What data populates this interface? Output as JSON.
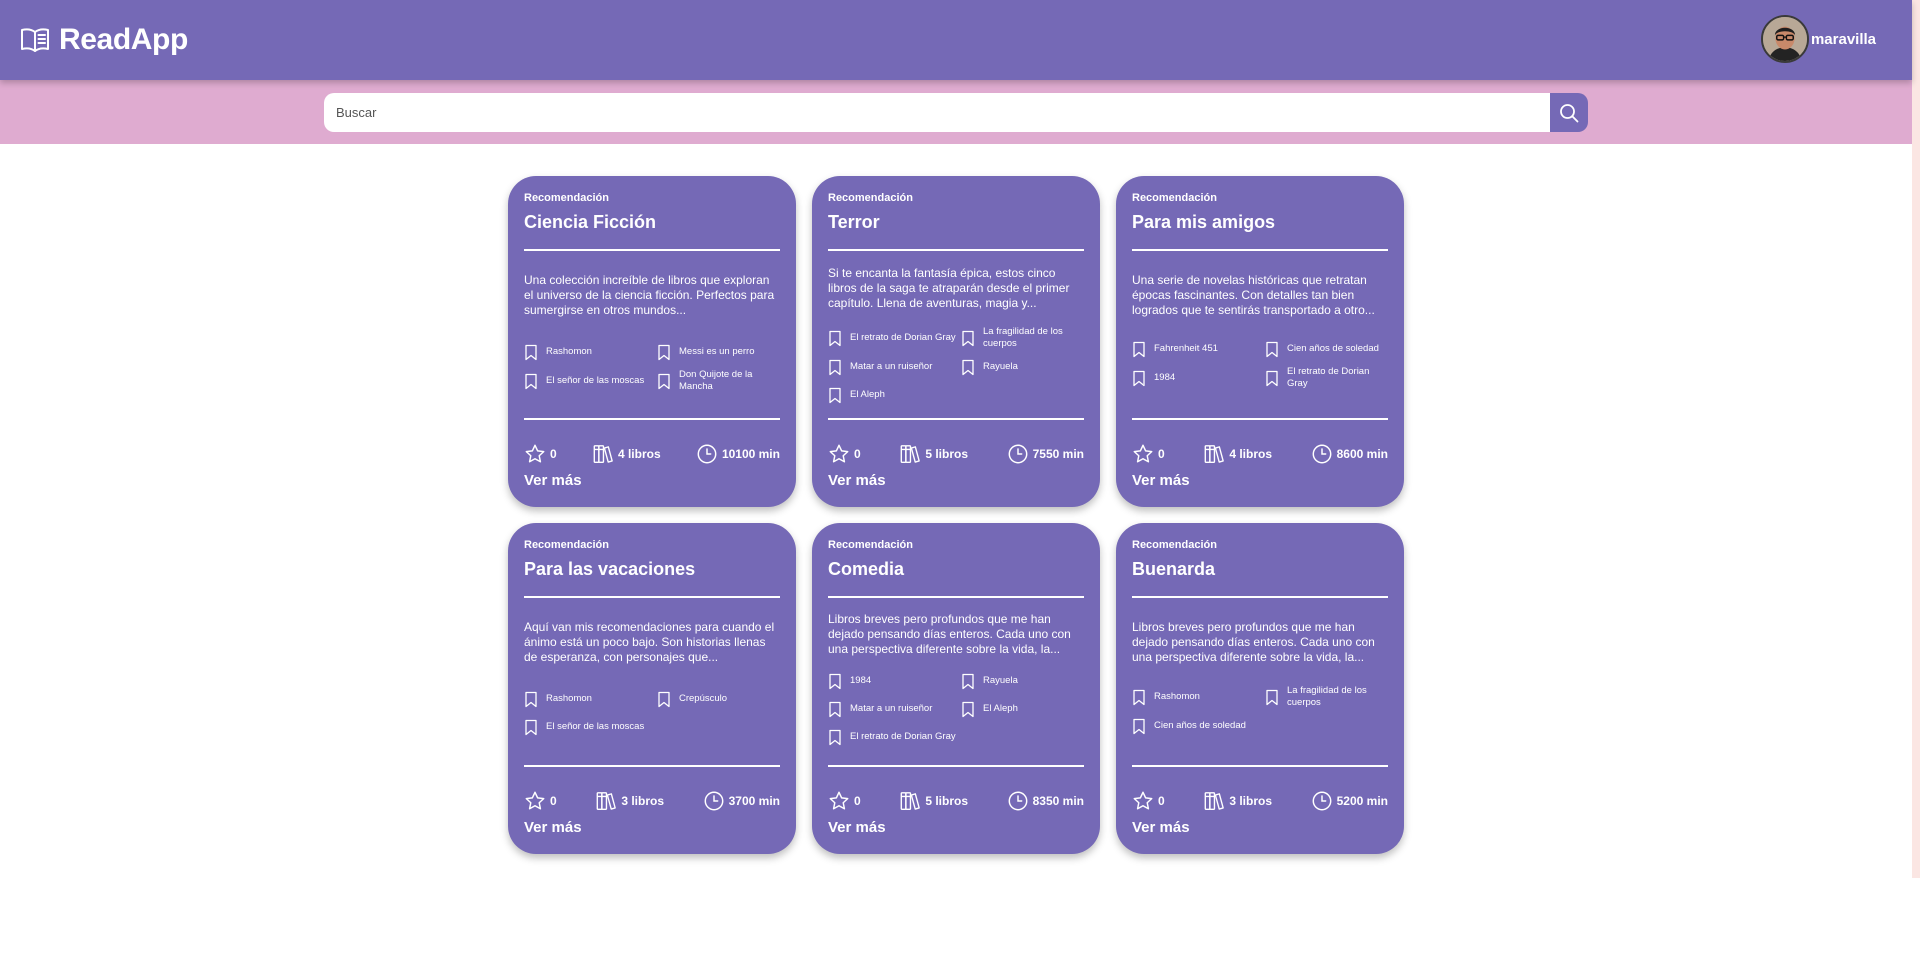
{
  "app": {
    "name": "ReadApp"
  },
  "user": {
    "name": "maravilla"
  },
  "search": {
    "placeholder": "Buscar",
    "value": ""
  },
  "cards": [
    {
      "eyebrow": "Recomendación",
      "title": "Ciencia Ficción",
      "description": "Una colección increíble de libros que exploran el universo de la ciencia ficción. Perfectos para sumergirse en otros mundos...",
      "books": [
        "Rashomon",
        "Messi es un perro",
        "El señor de las moscas",
        "Don Quijote de la Mancha"
      ],
      "rating": "0",
      "book_count": "4 libros",
      "minutes": "10100 min",
      "cta": "Ver más"
    },
    {
      "eyebrow": "Recomendación",
      "title": "Terror",
      "description": "Si te encanta la fantasía épica, estos cinco libros de la saga te atraparán desde el primer capítulo. Llena de aventuras, magia y...",
      "books": [
        "El retrato de Dorian Gray",
        "La fragilidad de los cuerpos",
        "Matar a un ruiseñor",
        "Rayuela",
        "El Aleph"
      ],
      "rating": "0",
      "book_count": "5 libros",
      "minutes": "7550 min",
      "cta": "Ver más"
    },
    {
      "eyebrow": "Recomendación",
      "title": "Para mis amigos",
      "description": "Una serie de novelas históricas que retratan épocas fascinantes. Con detalles tan bien logrados que te sentirás transportado a otro...",
      "books": [
        "Fahrenheit 451",
        "Cien años de soledad",
        "1984",
        "El retrato de Dorian Gray"
      ],
      "rating": "0",
      "book_count": "4 libros",
      "minutes": "8600 min",
      "cta": "Ver más"
    },
    {
      "eyebrow": "Recomendación",
      "title": "Para las vacaciones",
      "description": "Aquí van mis recomendaciones para cuando el ánimo está un poco bajo. Son historias llenas de esperanza, con personajes que...",
      "books": [
        "Rashomon",
        "Crepúsculo",
        "El señor de las moscas"
      ],
      "rating": "0",
      "book_count": "3 libros",
      "minutes": "3700 min",
      "cta": "Ver más"
    },
    {
      "eyebrow": "Recomendación",
      "title": "Comedia",
      "description": "Libros breves pero profundos que me han dejado pensando días enteros. Cada uno con una perspectiva diferente sobre la vida, la...",
      "books": [
        "1984",
        "Rayuela",
        "Matar a un ruiseñor",
        "El Aleph",
        "El retrato de Dorian Gray"
      ],
      "rating": "0",
      "book_count": "5 libros",
      "minutes": "8350 min",
      "cta": "Ver más"
    },
    {
      "eyebrow": "Recomendación",
      "title": "Buenarda",
      "description": "Libros breves pero profundos que me han dejado pensando días enteros. Cada uno con una perspectiva diferente sobre la vida, la...",
      "books": [
        "Rashomon",
        "La fragilidad de los cuerpos",
        "Cien años de soledad"
      ],
      "rating": "0",
      "book_count": "3 libros",
      "minutes": "5200 min",
      "cta": "Ver más"
    }
  ],
  "icons": {
    "brand": "open-book-icon",
    "search": "search-icon",
    "book": "bookmark-icon",
    "rating": "star-icon",
    "count": "books-icon",
    "time": "clock-icon"
  },
  "colors": {
    "primary": "#7569b6",
    "search_band": "#dfabd0",
    "text_on_primary": "#ffffff"
  }
}
